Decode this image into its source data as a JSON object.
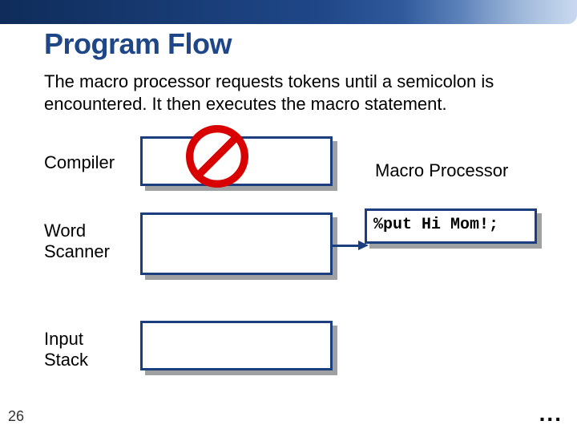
{
  "title": "Program Flow",
  "body": "The macro processor requests tokens until a semicolon is encountered. It then executes the macro statement.",
  "labels": {
    "compiler": "Compiler",
    "word_scanner_l1": "Word",
    "word_scanner_l2": "Scanner",
    "input_stack_l1": "Input",
    "input_stack_l2": "Stack",
    "macro_processor": "Macro Processor"
  },
  "macro_box_text": "%put Hi Mom!;",
  "slide_number": "26",
  "continuation": "...",
  "icons": {
    "prohibit": "prohibit-icon",
    "arrow": "arrow-right-icon"
  }
}
